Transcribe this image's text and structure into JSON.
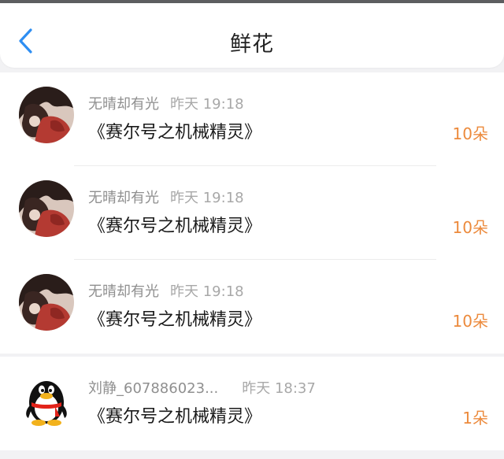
{
  "header": {
    "title": "鲜花"
  },
  "colors": {
    "accent_blue": "#2e8ef2",
    "count_orange": "#ec8a3c",
    "meta_gray": "#a8a8a8"
  },
  "records": [
    {
      "user": "无晴却有光",
      "time": "昨天 19:18",
      "book": "《赛尔号之机械精灵》",
      "count": "10朵",
      "avatar": "photo-avatar"
    },
    {
      "user": "无晴却有光",
      "time": "昨天 19:18",
      "book": "《赛尔号之机械精灵》",
      "count": "10朵",
      "avatar": "photo-avatar"
    },
    {
      "user": "无晴却有光",
      "time": "昨天 19:18",
      "book": "《赛尔号之机械精灵》",
      "count": "10朵",
      "avatar": "photo-avatar"
    },
    {
      "user": "刘静_607886023...",
      "time": "昨天 18:37",
      "book": "《赛尔号之机械精灵》",
      "count": "1朵",
      "avatar": "qq-penguin-icon"
    }
  ]
}
